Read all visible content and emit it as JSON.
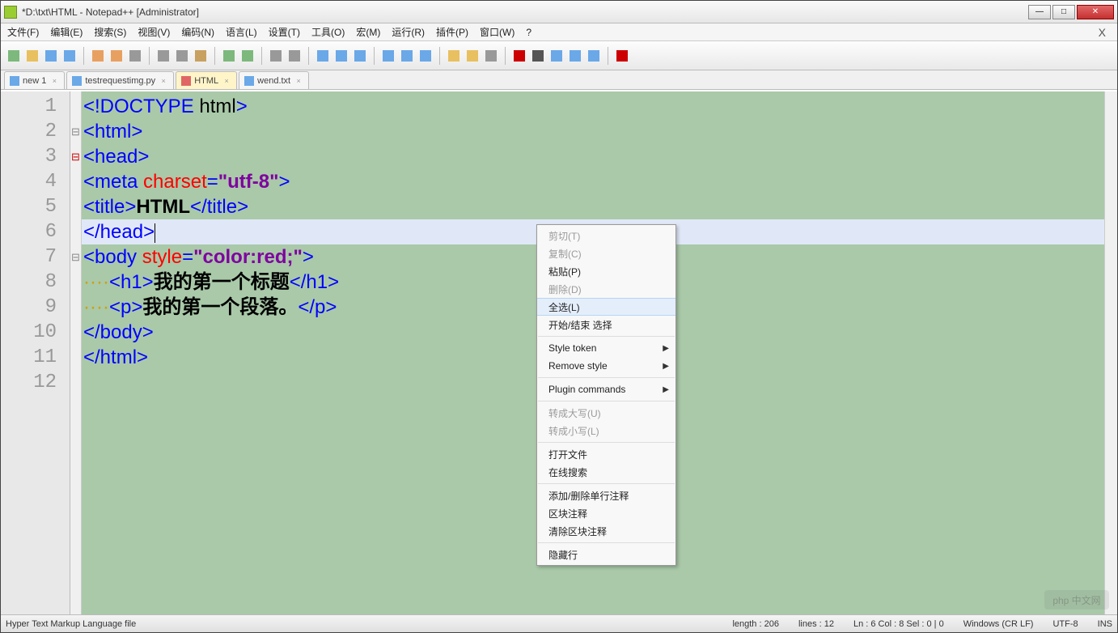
{
  "window": {
    "title": "*D:\\txt\\HTML - Notepad++ [Administrator]"
  },
  "menubar": {
    "items": [
      "文件(F)",
      "编辑(E)",
      "搜索(S)",
      "视图(V)",
      "编码(N)",
      "语言(L)",
      "设置(T)",
      "工具(O)",
      "宏(M)",
      "运行(R)",
      "插件(P)",
      "窗口(W)",
      "?"
    ],
    "close_doc": "X"
  },
  "tabs": [
    {
      "label": "new 1",
      "active": false
    },
    {
      "label": "testrequestimg.py",
      "active": false
    },
    {
      "label": "HTML",
      "active": true
    },
    {
      "label": "wend.txt",
      "active": false
    }
  ],
  "editor": {
    "line_numbers": [
      "1",
      "2",
      "3",
      "4",
      "5",
      "6",
      "7",
      "8",
      "9",
      "10",
      "11",
      "12"
    ],
    "fold_markers": [
      "",
      "m",
      "r",
      "",
      "",
      "",
      "m",
      "",
      "",
      "",
      "",
      ""
    ],
    "current_line_index": 5,
    "lines": [
      {
        "spans": [
          [
            "t-tag",
            "<!DOCTYPE "
          ],
          [
            "t-dt",
            "html"
          ],
          [
            "t-tag",
            ">"
          ]
        ]
      },
      {
        "spans": [
          [
            "t-tag",
            "<html>"
          ]
        ]
      },
      {
        "spans": [
          [
            "t-tag",
            "<head>"
          ]
        ]
      },
      {
        "spans": [
          [
            "t-tag",
            "<meta "
          ],
          [
            "t-attr",
            "charset"
          ],
          [
            "t-tag",
            "="
          ],
          [
            "t-str",
            "\"utf-8\""
          ],
          [
            "t-tag",
            ">"
          ]
        ]
      },
      {
        "spans": [
          [
            "t-tag",
            "<title>"
          ],
          [
            "t-txt",
            "HTML"
          ],
          [
            "t-tag",
            "</title>"
          ]
        ]
      },
      {
        "spans": [
          [
            "t-tag",
            "</head>"
          ]
        ]
      },
      {
        "spans": [
          [
            "t-tag",
            "<body "
          ],
          [
            "t-attr",
            "style"
          ],
          [
            "t-tag",
            "="
          ],
          [
            "t-str",
            "\"color:red;\""
          ],
          [
            "t-tag",
            ">"
          ]
        ]
      },
      {
        "indent": "    ",
        "spans": [
          [
            "t-tag",
            "<h1>"
          ],
          [
            "t-txt",
            "我的第一个标题"
          ],
          [
            "t-tag",
            "</h1>"
          ]
        ]
      },
      {
        "indent": "    ",
        "spans": [
          [
            "t-tag",
            "<p>"
          ],
          [
            "t-txt",
            "我的第一个段落。"
          ],
          [
            "t-tag",
            "</p>"
          ]
        ]
      },
      {
        "spans": [
          [
            "t-tag",
            "</body>"
          ]
        ]
      },
      {
        "spans": [
          [
            "t-tag",
            "</html>"
          ]
        ]
      },
      {
        "spans": []
      }
    ]
  },
  "context_menu": {
    "items": [
      {
        "label": "剪切(T)",
        "disabled": true
      },
      {
        "label": "复制(C)",
        "disabled": true
      },
      {
        "label": "粘贴(P)",
        "disabled": false
      },
      {
        "label": "删除(D)",
        "disabled": true
      },
      {
        "label": "全选(L)",
        "disabled": false,
        "hover": true
      },
      {
        "label": "开始/结束 选择",
        "disabled": false
      },
      {
        "sep": true
      },
      {
        "label": "Style token",
        "disabled": false,
        "sub": true
      },
      {
        "label": "Remove style",
        "disabled": false,
        "sub": true
      },
      {
        "sep": true
      },
      {
        "label": "Plugin commands",
        "disabled": false,
        "sub": true
      },
      {
        "sep": true
      },
      {
        "label": "转成大写(U)",
        "disabled": true
      },
      {
        "label": "转成小写(L)",
        "disabled": true
      },
      {
        "sep": true
      },
      {
        "label": "打开文件",
        "disabled": false
      },
      {
        "label": "在线搜索",
        "disabled": false
      },
      {
        "sep": true
      },
      {
        "label": "添加/删除单行注释",
        "disabled": false
      },
      {
        "label": "区块注释",
        "disabled": false
      },
      {
        "label": "清除区块注释",
        "disabled": false
      },
      {
        "sep": true
      },
      {
        "label": "隐藏行",
        "disabled": false
      }
    ]
  },
  "statusbar": {
    "lang": "Hyper Text Markup Language file",
    "length": "length : 206",
    "lines": "lines : 12",
    "pos": "Ln : 6    Col : 8    Sel : 0 | 0",
    "eol": "Windows (CR LF)",
    "enc": "UTF-8",
    "ins": "INS"
  },
  "watermark": "php 中文网",
  "icons": {
    "toolbar": [
      "new-file",
      "open-file",
      "save",
      "save-all",
      "",
      "close",
      "close-all",
      "print",
      "",
      "cut",
      "copy",
      "paste",
      "",
      "undo",
      "redo",
      "",
      "find",
      "replace",
      "",
      "zoom-in",
      "zoom-out",
      "sync",
      "",
      "word-wrap",
      "all-chars",
      "indent-guide",
      "",
      "lang",
      "folder",
      "eye",
      "",
      "record",
      "stop",
      "play-last",
      "play-multi",
      "save-macro",
      "",
      "spellcheck"
    ]
  }
}
